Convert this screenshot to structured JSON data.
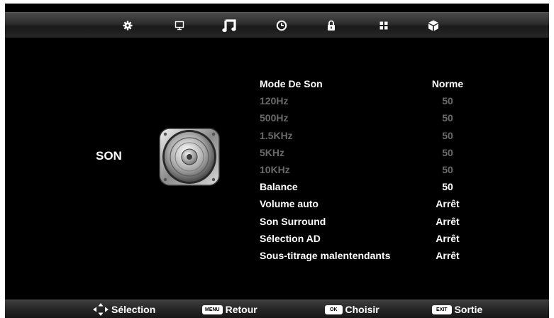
{
  "top_tabs": [
    {
      "icon": "gear-icon",
      "selected": false
    },
    {
      "icon": "monitor-icon",
      "selected": false
    },
    {
      "icon": "music-note-icon",
      "selected": true
    },
    {
      "icon": "clock-icon",
      "selected": false
    },
    {
      "icon": "lock-icon",
      "selected": false
    },
    {
      "icon": "apps-grid-icon",
      "selected": false
    },
    {
      "icon": "cube-icon",
      "selected": false
    }
  ],
  "section_title": "SON",
  "settings": [
    {
      "label": "Mode De Son",
      "value": "Norme",
      "enabled": true
    },
    {
      "label": "120Hz",
      "value": "50",
      "enabled": false
    },
    {
      "label": "500Hz",
      "value": "50",
      "enabled": false
    },
    {
      "label": "1.5KHz",
      "value": "50",
      "enabled": false
    },
    {
      "label": "5KHz",
      "value": "50",
      "enabled": false
    },
    {
      "label": "10KHz",
      "value": "50",
      "enabled": false
    },
    {
      "label": "Balance",
      "value": "50",
      "enabled": true
    },
    {
      "label": "Volume auto",
      "value": "Arrêt",
      "enabled": true
    },
    {
      "label": "Son Surround",
      "value": "Arrêt",
      "enabled": true
    },
    {
      "label": "Sélection AD",
      "value": "Arrêt",
      "enabled": true
    },
    {
      "label": "Sous-titrage malentendants",
      "value": "Arrêt",
      "enabled": true
    }
  ],
  "footer": {
    "select_label": "Sélection",
    "menu_key": "MENU",
    "back_label": "Retour",
    "ok_key": "OK",
    "choose_label": "Choisir",
    "exit_key": "EXIT",
    "exit_label": "Sortie"
  },
  "colors": {
    "enabled_text": "#ffffff",
    "disabled_text": "#6a6a6a",
    "background": "#000000"
  }
}
